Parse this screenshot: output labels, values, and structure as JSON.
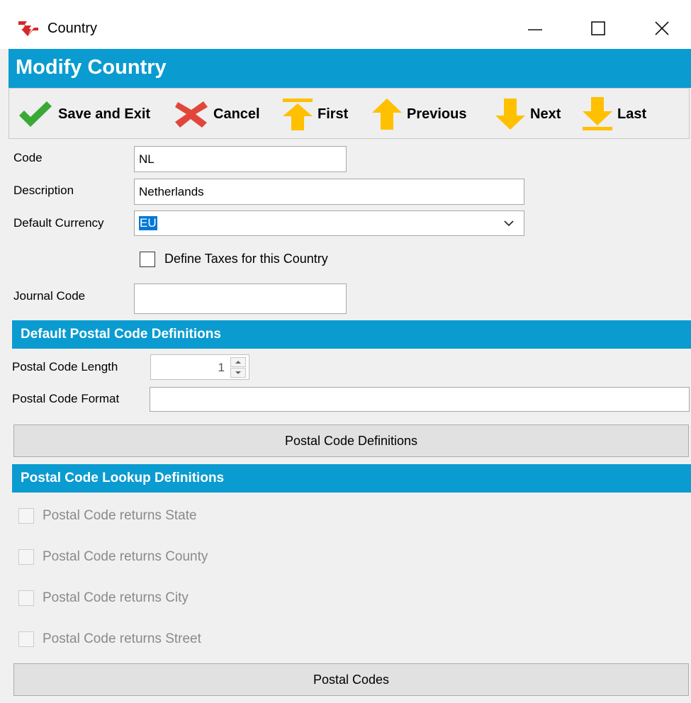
{
  "window": {
    "title": "Country",
    "icon": "app-logo-icon",
    "controls": [
      "minimize-icon",
      "maximize-icon",
      "close-icon"
    ]
  },
  "header": {
    "title": "Modify Country"
  },
  "toolbar": {
    "save_exit": "Save and Exit",
    "cancel": "Cancel",
    "first": "First",
    "previous": "Previous",
    "next": "Next",
    "last": "Last"
  },
  "form": {
    "code_label": "Code",
    "code_value": "NL",
    "description_label": "Description",
    "description_value": "Netherlands",
    "currency_label": "Default Currency",
    "currency_value": "EU",
    "define_taxes_label": "Define Taxes for this Country",
    "define_taxes_checked": false,
    "journal_code_label": "Journal Code",
    "journal_code_value": ""
  },
  "postal_defaults": {
    "section_title": "Default Postal Code Definitions",
    "length_label": "Postal Code Length",
    "length_value": "1",
    "format_label": "Postal Code Format",
    "format_value": "",
    "definitions_button": "Postal Code Definitions"
  },
  "postal_lookup": {
    "section_title": "Postal Code Lookup Definitions",
    "options": [
      "Postal Code returns State",
      "Postal Code returns County",
      "Postal Code returns City",
      "Postal Code returns Street"
    ],
    "codes_button": "Postal Codes"
  },
  "colors": {
    "header_blue": "#0a9bd0",
    "check_green": "#3aa935",
    "cancel_red": "#e2463a",
    "arrow_yellow": "#ffc000"
  }
}
